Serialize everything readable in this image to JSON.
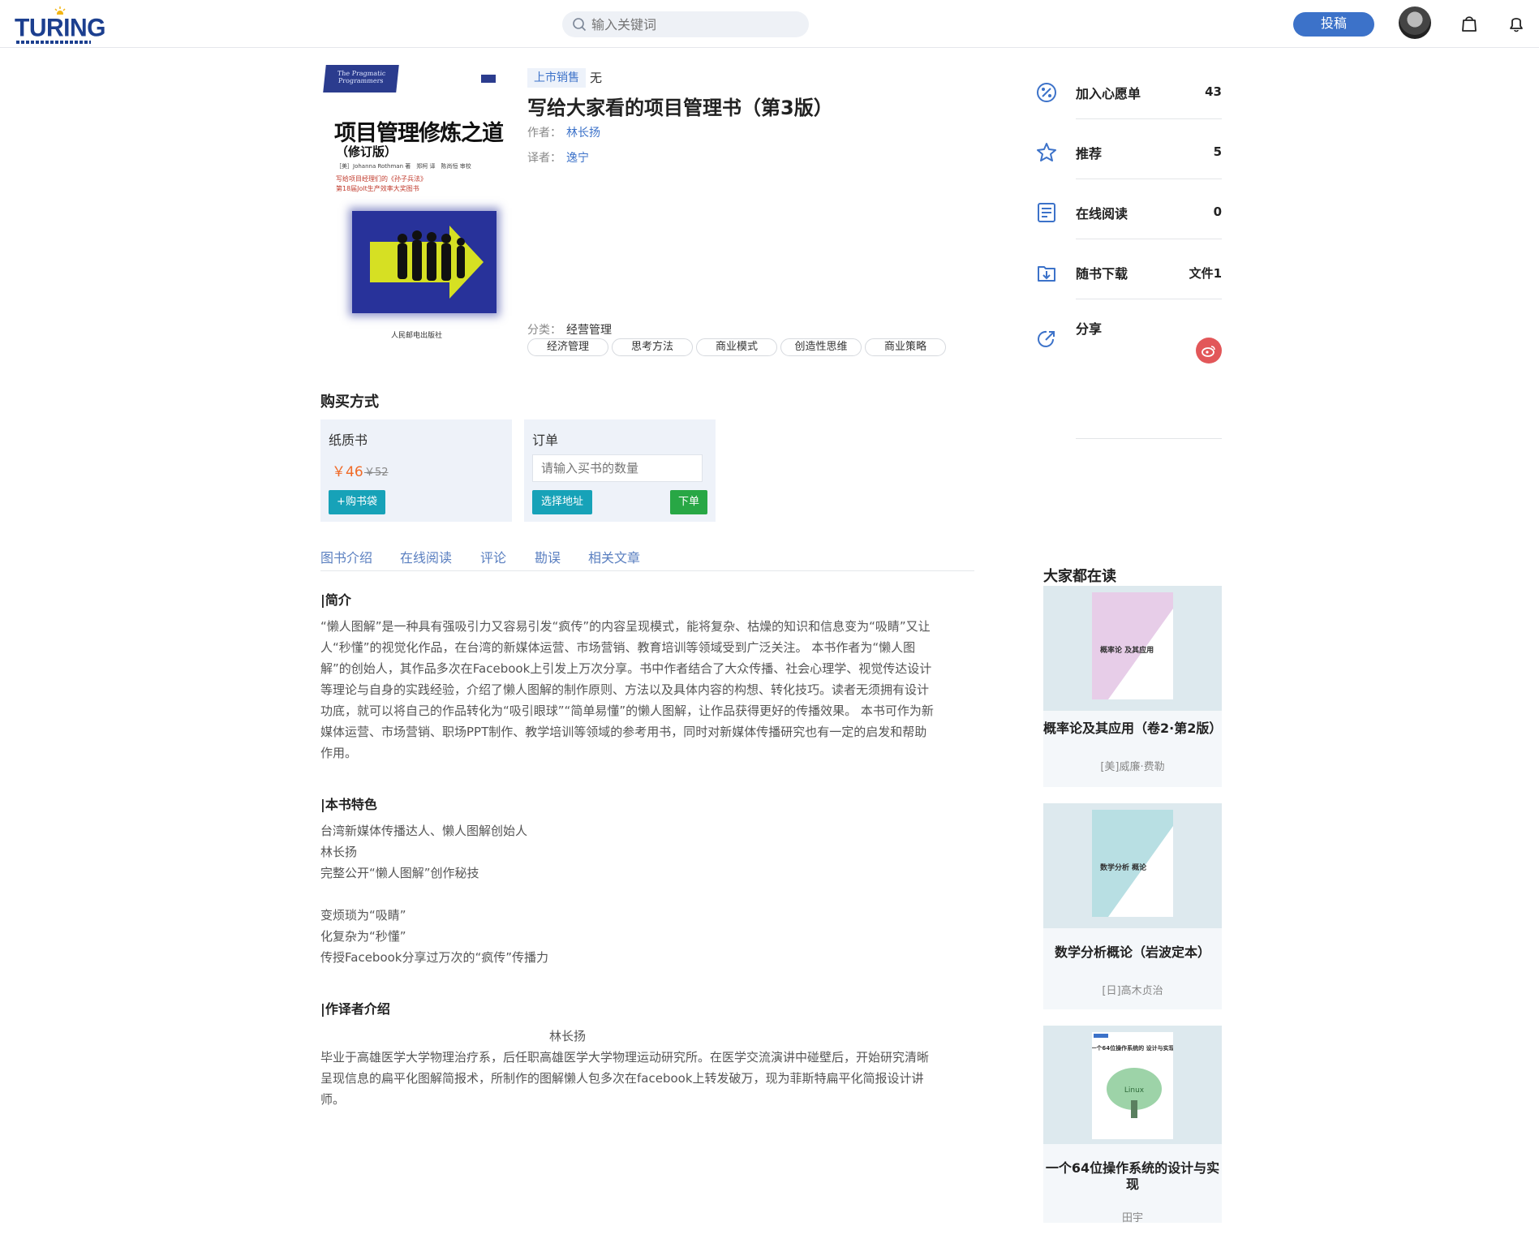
{
  "header": {
    "logo_text": "TURING",
    "search_placeholder": "输入关键词",
    "contribute_label": "投稿"
  },
  "cover": {
    "series": "The Pragmatic Programmers",
    "title": "项目管理修炼之道",
    "edition": "（修订版）",
    "authors": "［美］Johanna Rothman 著　郑柯 译　陈尚恒 审校",
    "slogan1": "写给项目经理们的《孙子兵法》",
    "slogan2": "第18届Jolt生产效率大奖图书",
    "publisher": "人民邮电出版社"
  },
  "book": {
    "status_tag": "上市销售",
    "status_value": "无",
    "title": "写给大家看的项目管理书（第3版）",
    "author_label": "作者：",
    "author": "林长扬",
    "translator_label": "译者：",
    "translator": "逸宁",
    "category_label": "分类：",
    "category": "经营管理",
    "tags": [
      "经济管理",
      "思考方法",
      "商业模式",
      "创造性思维",
      "商业策略"
    ]
  },
  "actions": [
    {
      "icon": "wishlist-icon",
      "label": "加入心愿单",
      "count": "43"
    },
    {
      "icon": "recommend-star-icon",
      "label": "推荐",
      "count": "5"
    },
    {
      "icon": "online-read-icon",
      "label": "在线阅读",
      "count": "0"
    },
    {
      "icon": "download-icon",
      "label": "随书下载",
      "count": "文件1"
    },
    {
      "icon": "share-icon",
      "label": "分享",
      "count": ""
    }
  ],
  "purchase": {
    "heading": "购买方式",
    "paper": {
      "label": "纸质书",
      "price": "￥46",
      "original_price": "￥52",
      "add_cart_label": "+购书袋"
    },
    "order": {
      "label": "订单",
      "qty_placeholder": "请输入买书的数量",
      "address_label": "选择地址",
      "submit_label": "下单"
    }
  },
  "tabs": [
    "图书介绍",
    "在线阅读",
    "评论",
    "勘误",
    "相关文章"
  ],
  "content": {
    "intro_heading": "|简介",
    "intro_lines": [
      "“懒人图解”是一种具有强吸引力又容易引发“疯传”的内容呈现模式，能将复杂、枯燥的知识和信息变为“吸睛”又让",
      "人“秒懂”的视觉化作品，在台湾的新媒体运营、市场营销、教育培训等领域受到广泛关注。 本书作者为“懒人图",
      "解”的创始人，其作品多次在Facebook上引发上万次分享。书中作者结合了大众传播、社会心理学、视觉传达设计",
      "等理论与自身的实践经验，介绍了懒人图解的制作原则、方法以及具体内容的构想、转化技巧。读者无须拥有设计",
      "功底，就可以将自己的作品转化为“吸引眼球”“简单易懂”的懒人图解，让作品获得更好的传播效果。 本书可作为新",
      "媒体运营、市场营销、职场PPT制作、教学培训等领域的参考用书，同时对新媒体传播研究也有一定的启发和帮助",
      "作用。"
    ],
    "features_heading": "|本书特色",
    "features_lines": [
      "台湾新媒体传播达人、懒人图解创始人",
      "林长扬",
      "完整公开“懒人图解”创作秘技",
      "",
      "变烦琐为“吸睛”",
      "化复杂为“秒懂”",
      "传授Facebook分享过万次的“疯传”传播力"
    ],
    "author_heading": "|作译者介绍",
    "author_name": "林长扬",
    "author_lines": [
      "毕业于高雄医学大学物理治疗系，后任职高雄医学大学物理运动研究所。在医学交流演讲中碰壁后，开始研究清晰",
      "呈现信息的扁平化图解简报术，所制作的图解懒人包多次在facebook上转发破万，现为菲斯特扁平化简报设计讲",
      "师。"
    ]
  },
  "side": {
    "heading": "大家都在读",
    "books": [
      {
        "title": "概率论及其应用（卷2·第2版）",
        "author": "[美]威廉·费勒",
        "cover_text": "概率论 及其应用",
        "cover_color": "#e7cde8"
      },
      {
        "title": "数学分析概论（岩波定本）",
        "author": "[日]高木贞治",
        "cover_text": "数学分析 概论",
        "cover_color": "#b8dfe3"
      },
      {
        "title": "一个64位操作系统的设计与实现",
        "author": "田宇",
        "cover_text": "一个64位操作系统的 设计与实现",
        "cover_color": "#ffffff"
      }
    ]
  },
  "colors": {
    "accent": "#3c72c9",
    "price": "#f06a27",
    "teal_button": "#17a2b8",
    "green_button": "#28a745",
    "share_red": "#e25759"
  }
}
